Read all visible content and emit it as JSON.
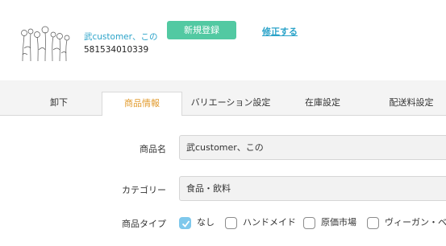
{
  "header": {
    "product_name": "武customer、この",
    "product_id": "581534010339",
    "new_register_label": "新規登録",
    "edit_label": "修正する"
  },
  "tabs": [
    {
      "label": "卸下",
      "active": false
    },
    {
      "label": "商品情報",
      "active": true
    },
    {
      "label": "バリエーション設定",
      "active": false
    },
    {
      "label": "在庫設定",
      "active": false
    },
    {
      "label": "配送料設定",
      "active": false
    }
  ],
  "form": {
    "name_label": "商品名",
    "name_value": "武customer、この",
    "category_label": "カテゴリー",
    "category_value": "食品・飲料",
    "type_label": "商品タイプ",
    "type_options": [
      {
        "label": "なし",
        "checked": true
      },
      {
        "label": "ハンドメイド",
        "checked": false
      },
      {
        "label": "原価市場",
        "checked": false
      },
      {
        "label": "ヴィーガン・ベジ",
        "checked": false
      }
    ]
  },
  "colors": {
    "accent": "#2ba3c9",
    "button": "#52c9a2",
    "active_tab": "#e29b2e",
    "checkbox_checked": "#7fc8ec"
  }
}
